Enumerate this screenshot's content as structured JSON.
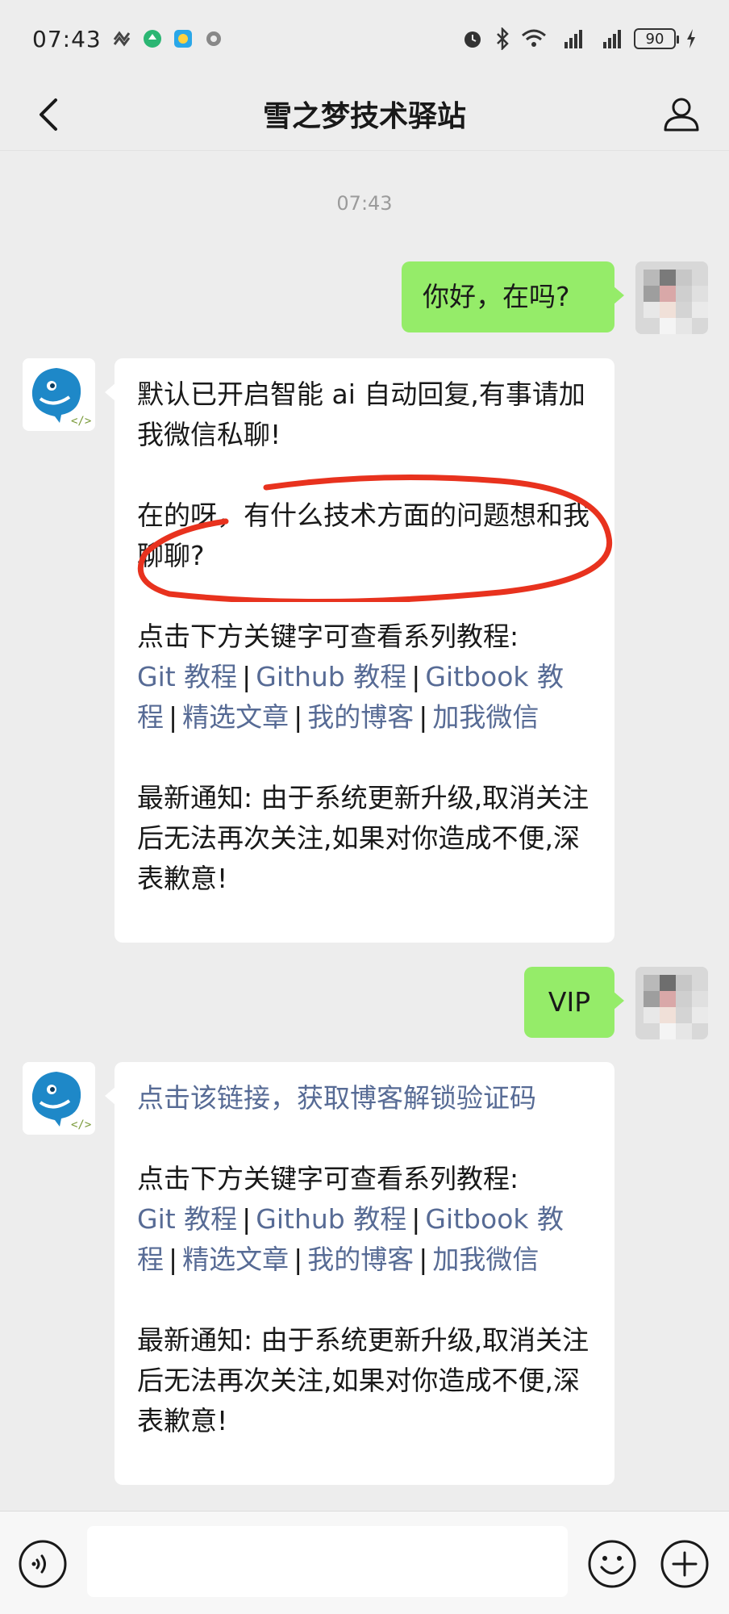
{
  "status_bar": {
    "time": "07:43",
    "battery": "90"
  },
  "header": {
    "title": "雪之梦技术驿站"
  },
  "chat": {
    "timestamp": "07:43",
    "messages": [
      {
        "from": "me",
        "text": "你好，在吗?"
      },
      {
        "from": "bot",
        "p1": "默认已开启智能 ai 自动回复,有事请加我微信私聊!",
        "p2": "在的呀，有什么技术方面的问题想和我聊聊?",
        "p3_intro": "点击下方关键字可查看系列教程:",
        "links": [
          "Git 教程",
          "Github 教程",
          "Gitbook 教程",
          "精选文章",
          "我的博客",
          "加我微信"
        ],
        "separator": "|",
        "p4": "最新通知: 由于系统更新升级,取消关注后无法再次关注,如果对你造成不便,深表歉意!"
      },
      {
        "from": "me",
        "text": "VIP"
      },
      {
        "from": "bot",
        "unlock_link": "点击该链接，获取博客解锁验证码",
        "p3_intro": "点击下方关键字可查看系列教程:",
        "links": [
          "Git 教程",
          "Github 教程",
          "Gitbook 教程",
          "精选文章",
          "我的博客",
          "加我微信"
        ],
        "separator": "|",
        "p4": "最新通知: 由于系统更新升级,取消关注后无法再次关注,如果对你造成不便,深表歉意!"
      }
    ]
  },
  "input": {
    "placeholder": ""
  },
  "colors": {
    "outgoing_bubble": "#95ec69",
    "link": "#576b95",
    "annotation": "#e8321e",
    "bot_bird": "#1e88c8"
  },
  "icons": [
    "back-icon",
    "person-icon",
    "voice-icon",
    "emoji-icon",
    "plus-icon",
    "alarm-icon",
    "bluetooth-icon",
    "wifi-icon",
    "signal-icon"
  ]
}
